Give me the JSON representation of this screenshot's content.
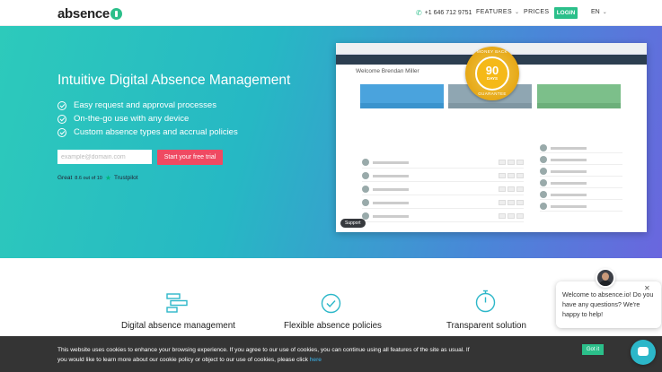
{
  "nav": {
    "brand": "absence",
    "phone": "+1 646 712 9751",
    "features_label": "FEATURES",
    "prices_label": "PRICES",
    "login_label": "LOGIN",
    "lang_label": "EN"
  },
  "hero": {
    "title": "Intuitive Digital Absence Management",
    "features": [
      "Easy request and approval processes",
      "On-the-go use with any device",
      "Custom absence types and accrual policies"
    ],
    "email_placeholder": "example@domain.com",
    "trial_label": "Start your free trial",
    "trustpilot": {
      "word": "Great",
      "rating": "8.6 out of 10",
      "brand": "Trustpilot"
    }
  },
  "mock": {
    "welcome": "Welcome Brendan Miller",
    "support_label": "Support"
  },
  "badge": {
    "top": "MONEY BACK",
    "number": "90",
    "days": "DAYS",
    "bottom": "GUARANTEE"
  },
  "columns": [
    {
      "title": "Digital absence management",
      "icon": "chart-icon"
    },
    {
      "title": "Flexible absence policies",
      "icon": "check-circle-icon"
    },
    {
      "title": "Transparent solution",
      "icon": "stopwatch-icon"
    }
  ],
  "chat": {
    "message": "Welcome to absence.io! Do you have any questions? We're happy to help!"
  },
  "cookie": {
    "text_1": "This website uses cookies to enhance your browsing experience. If you agree to our use of cookies, you can continue using all features of the site as usual. If",
    "text_2": "you would like to learn more about our cookie policy or object to our use of cookies, please click",
    "link_label": "here",
    "button_label": "Got it"
  },
  "colors": {
    "accent": "#2bbf8a",
    "cta": "#ef4a62",
    "chat": "#2cb7c9"
  }
}
